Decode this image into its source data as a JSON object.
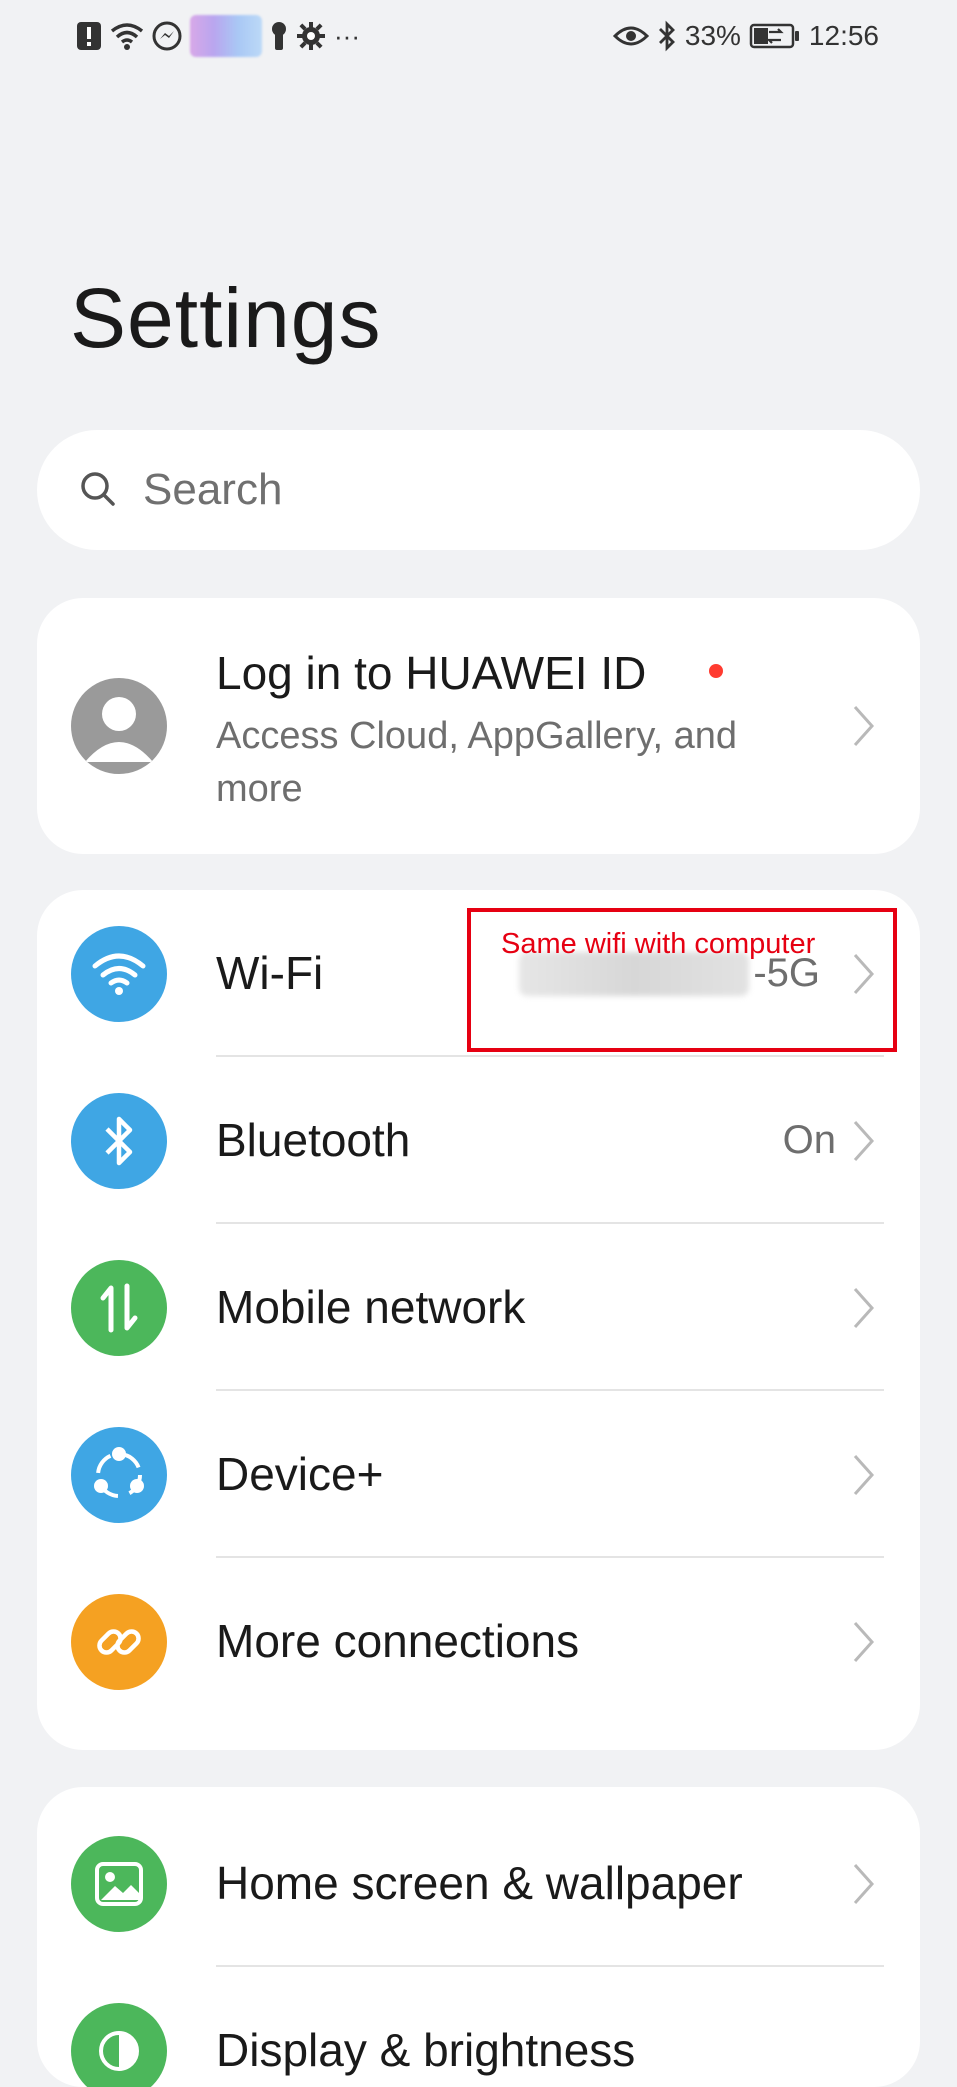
{
  "status_bar": {
    "left_icons": [
      "alert-icon",
      "wifi-icon",
      "messenger-icon",
      "blurred-icon",
      "keyhole-icon",
      "gear-icon",
      "more-icon"
    ],
    "overflow_glyph": "···",
    "battery_percent": "33%",
    "time": "12:56"
  },
  "page": {
    "title": "Settings"
  },
  "search": {
    "placeholder": "Search"
  },
  "account": {
    "title": "Log in to HUAWEI ID",
    "subtitle": "Access Cloud, AppGallery, and more"
  },
  "connections": [
    {
      "label": "Wi-Fi",
      "value": "-5G",
      "icon": "wifi-icon",
      "color": "#3fa6e4"
    },
    {
      "label": "Bluetooth",
      "value": "On",
      "icon": "bluetooth-icon",
      "color": "#3fa6e4"
    },
    {
      "label": "Mobile network",
      "value": "",
      "icon": "mobile-data-icon",
      "color": "#4cb75b"
    },
    {
      "label": "Device+",
      "value": "",
      "icon": "device-plus-icon",
      "color": "#3fa6e4"
    },
    {
      "label": "More connections",
      "value": "",
      "icon": "link-icon",
      "color": "#f5a122"
    }
  ],
  "display_group": [
    {
      "label": "Home screen & wallpaper",
      "icon": "image-icon",
      "color": "#4cb75b"
    },
    {
      "label": "Display & brightness",
      "icon": "brightness-icon",
      "color": "#4cb75b"
    }
  ],
  "annotation": {
    "text": "Same wifi with computer",
    "color": "#e60012"
  }
}
